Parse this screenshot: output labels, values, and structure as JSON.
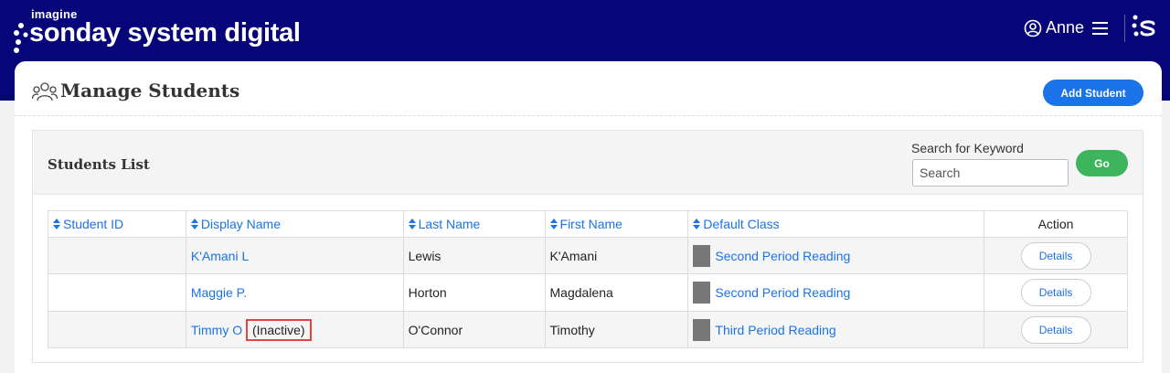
{
  "header": {
    "logo_top": "imagine",
    "logo_brand": "sonday system digital",
    "user_name": "Anne"
  },
  "page": {
    "title": "Manage Students",
    "add_button": "Add Student"
  },
  "panel": {
    "title": "Students List",
    "search_label": "Search for Keyword",
    "search_placeholder": "Search",
    "go_button": "Go"
  },
  "table": {
    "columns": {
      "student_id": "Student ID",
      "display_name": "Display Name",
      "last_name": "Last Name",
      "first_name": "First Name",
      "default_class": "Default Class",
      "action": "Action"
    },
    "rows": [
      {
        "student_id": "",
        "display_name": "K'Amani L",
        "status": "",
        "last_name": "Lewis",
        "first_name": "K'Amani",
        "default_class": "Second Period Reading",
        "action": "Details"
      },
      {
        "student_id": "",
        "display_name": "Maggie P.",
        "status": "",
        "last_name": "Horton",
        "first_name": "Magdalena",
        "default_class": "Second Period Reading",
        "action": "Details"
      },
      {
        "student_id": "",
        "display_name": "Timmy O",
        "status": "(Inactive)",
        "last_name": "O'Connor",
        "first_name": "Timothy",
        "default_class": "Third Period Reading",
        "action": "Details"
      }
    ]
  },
  "colors": {
    "header_bg": "#06067a",
    "primary": "#1a73e8",
    "go_green": "#3cb55c",
    "highlight_red": "#e04444"
  },
  "icons": [
    "sonday-dots-icon",
    "user-circle-icon",
    "hamburger-menu-icon",
    "sonday-s-icon",
    "students-group-icon",
    "sort-icon"
  ]
}
